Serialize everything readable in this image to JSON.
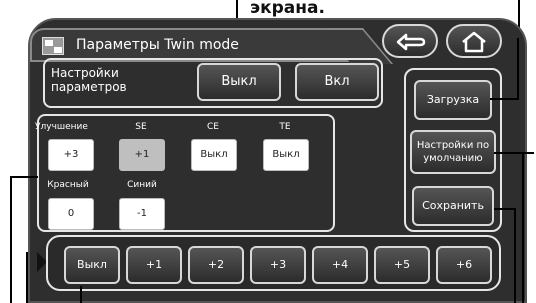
{
  "caption": {
    "text": "экрана."
  },
  "window": {
    "title": "Параметры Twin mode"
  },
  "nav": {
    "back_icon": "back-arrow-icon",
    "home_icon": "home-icon"
  },
  "settings": {
    "label": "Настройки параметров",
    "off_label": "Выкл",
    "on_label": "Вкл"
  },
  "params": {
    "improvement": {
      "label": "Улучшение",
      "value": "+3"
    },
    "se": {
      "label": "SE",
      "value": "+1"
    },
    "ce": {
      "label": "CE",
      "value": "Выкл"
    },
    "te": {
      "label": "TE",
      "value": "Выкл"
    },
    "red": {
      "label": "Красный",
      "value": "0"
    },
    "blue": {
      "label": "Синий",
      "value": "-1"
    }
  },
  "side": {
    "load_label": "Загрузка",
    "defaults_label": "Настройки по умолчанию",
    "save_label": "Сохранить"
  },
  "levels": {
    "items": [
      "Выкл",
      "+1",
      "+2",
      "+3",
      "+4",
      "+5",
      "+6"
    ]
  }
}
